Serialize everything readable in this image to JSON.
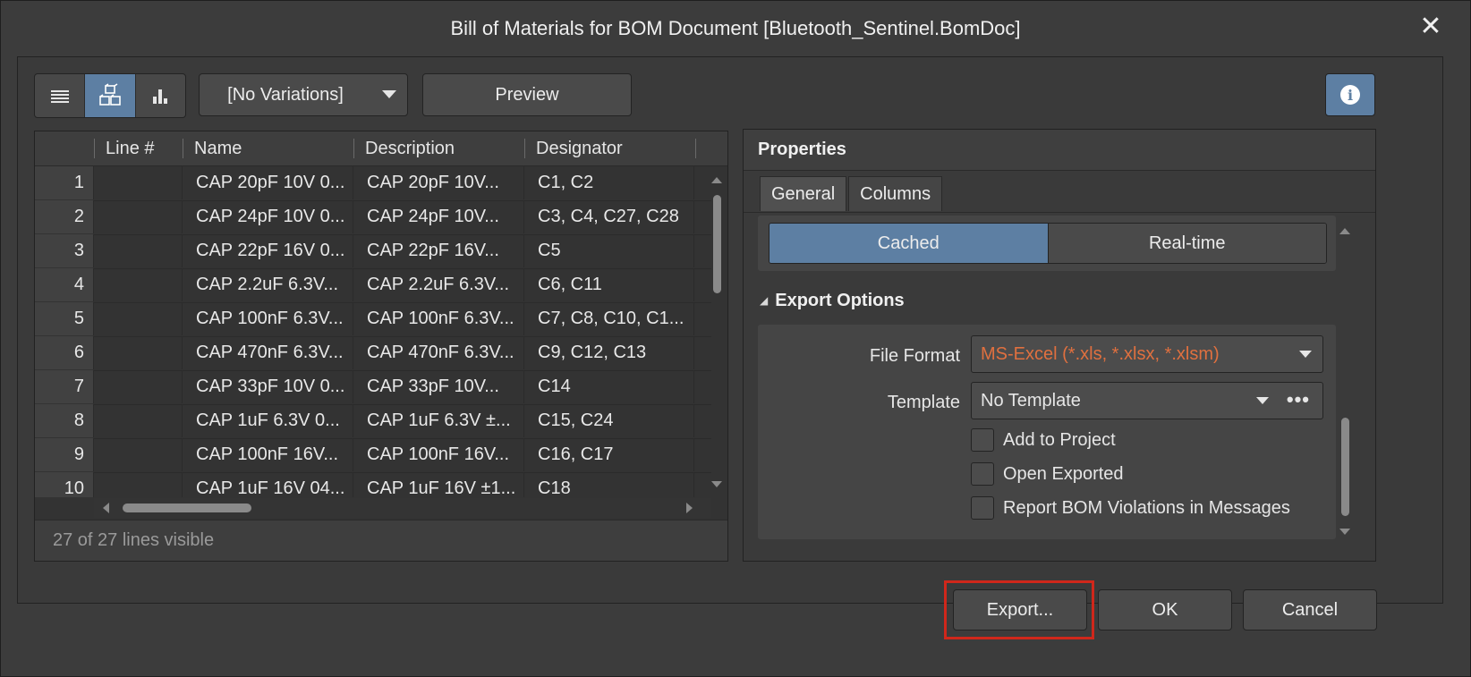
{
  "window": {
    "title": "Bill of Materials for BOM Document [Bluetooth_Sentinel.BomDoc]",
    "close_icon": "close-icon"
  },
  "toolbar": {
    "view_modes": [
      {
        "name": "list-view-icon",
        "active": false
      },
      {
        "name": "cube-view-icon",
        "active": true
      },
      {
        "name": "chart-view-icon",
        "active": false
      }
    ],
    "variations_label": "[No Variations]",
    "preview_label": "Preview",
    "info_glyph": "i"
  },
  "grid": {
    "columns": [
      "Line #",
      "Name",
      "Description",
      "Designator"
    ],
    "rows": [
      {
        "n": "1",
        "line": "",
        "name": "CAP 20pF 10V 0...",
        "desc": "CAP 20pF 10V...",
        "des": "C1, C2"
      },
      {
        "n": "2",
        "line": "",
        "name": "CAP 24pF 10V 0...",
        "desc": "CAP 24pF 10V...",
        "des": "C3, C4, C27, C28"
      },
      {
        "n": "3",
        "line": "",
        "name": "CAP 22pF 16V 0...",
        "desc": "CAP 22pF 16V...",
        "des": "C5"
      },
      {
        "n": "4",
        "line": "",
        "name": "CAP 2.2uF 6.3V...",
        "desc": "CAP 2.2uF 6.3V...",
        "des": "C6, C11"
      },
      {
        "n": "5",
        "line": "",
        "name": "CAP 100nF 6.3V...",
        "desc": "CAP 100nF 6.3V...",
        "des": "C7, C8, C10, C1..."
      },
      {
        "n": "6",
        "line": "",
        "name": "CAP 470nF 6.3V...",
        "desc": "CAP 470nF 6.3V...",
        "des": "C9, C12, C13"
      },
      {
        "n": "7",
        "line": "",
        "name": "CAP 33pF 10V 0...",
        "desc": "CAP 33pF 10V...",
        "des": "C14"
      },
      {
        "n": "8",
        "line": "",
        "name": "CAP 1uF 6.3V 0...",
        "desc": "CAP 1uF 6.3V ±...",
        "des": "C15, C24"
      },
      {
        "n": "9",
        "line": "",
        "name": "CAP 100nF 16V...",
        "desc": "CAP 100nF 16V...",
        "des": "C16, C17"
      },
      {
        "n": "10",
        "line": "",
        "name": "CAP 1uF 16V 04...",
        "desc": "CAP 1uF 16V ±1...",
        "des": "C18"
      }
    ],
    "status": "27 of 27 lines visible"
  },
  "properties": {
    "title": "Properties",
    "tabs": [
      "General",
      "Columns"
    ],
    "source_options": [
      "Cached",
      "Real-time"
    ],
    "export_section": "Export Options",
    "file_format_label": "File Format",
    "file_format_value": "MS-Excel (*.xls, *.xlsx, *.xlsm)",
    "file_format_color": "#e0703f",
    "template_label": "Template",
    "template_value": "No Template",
    "checkboxes": [
      "Add to Project",
      "Open Exported",
      "Report BOM Violations in Messages"
    ]
  },
  "footer": {
    "export_label": "Export...",
    "ok_label": "OK",
    "cancel_label": "Cancel"
  },
  "colors": {
    "accent": "#5d7fa3",
    "highlight": "#d0271b"
  }
}
